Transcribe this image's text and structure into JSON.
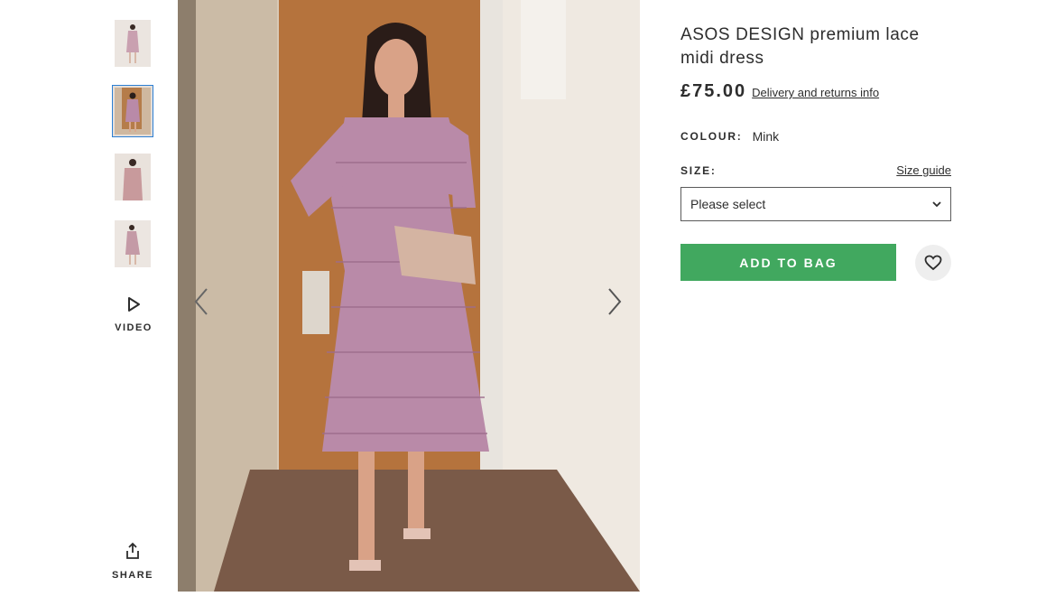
{
  "product": {
    "title": "ASOS DESIGN premium lace midi dress",
    "price": "£75.00",
    "delivery_link": "Delivery and returns info",
    "colour_label": "COLOUR:",
    "colour_value": "Mink",
    "size_label": "SIZE:",
    "size_guide": "Size guide",
    "size_placeholder": "Please select",
    "add_to_bag": "ADD TO BAG"
  },
  "gallery": {
    "thumbnails": [
      {
        "icon": "product-photo-thumbnail"
      },
      {
        "icon": "product-photo-thumbnail",
        "selected": true
      },
      {
        "icon": "product-photo-thumbnail"
      },
      {
        "icon": "product-photo-thumbnail"
      }
    ],
    "video_label": "VIDEO",
    "share_label": "SHARE"
  },
  "colors": {
    "add_button": "#41a85f",
    "dress": "#b98aa8",
    "thumb_border": "#2d7fd3"
  }
}
